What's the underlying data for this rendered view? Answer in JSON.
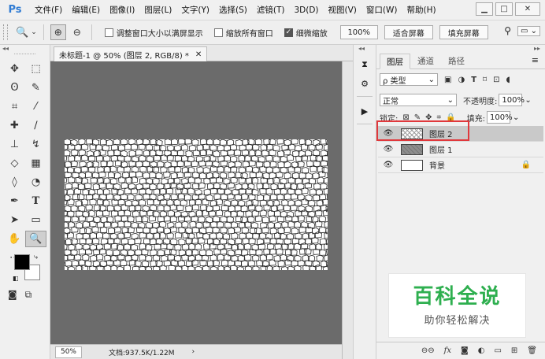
{
  "app": {
    "logo": "Ps",
    "menu": [
      "文件(F)",
      "编辑(E)",
      "图像(I)",
      "图层(L)",
      "文字(Y)",
      "选择(S)",
      "滤镜(T)",
      "3D(D)",
      "视图(V)",
      "窗口(W)",
      "帮助(H)"
    ],
    "window_controls": {
      "minimize": "▁",
      "maximize": "□",
      "close": "✕"
    }
  },
  "options": {
    "tool_icon": "magnifier-icon",
    "resize_windows": "调整窗口大小以满屏显示",
    "zoom_all_windows": "缩放所有窗口",
    "scrubby_zoom": "细微缩放",
    "resize_windows_checked": false,
    "zoom_all_checked": false,
    "scrubby_checked": true,
    "btn_100": "100%",
    "btn_fit": "适合屏幕",
    "btn_fill": "填充屏幕"
  },
  "document": {
    "tab_title": "未标题-1 @ 50% (图层 2, RGB/8) *",
    "zoom": "50%",
    "doc_info": "文档:937.5K/1.22M"
  },
  "layers_panel": {
    "tabs": [
      "图层",
      "通道",
      "路径"
    ],
    "filter_kind": "ρ 类型",
    "blend_mode": "正常",
    "opacity_label": "不透明度:",
    "opacity_value": "100%",
    "lock_label": "锁定:",
    "fill_label": "填充:",
    "fill_value": "100%",
    "layers": [
      {
        "name": "图层 2",
        "selected": true,
        "thumb": "pattern"
      },
      {
        "name": "图层 1",
        "selected": false,
        "thumb": "gray"
      },
      {
        "name": "背景",
        "selected": false,
        "thumb": "white",
        "locked": true
      }
    ]
  },
  "watermark": {
    "title": "百科全说",
    "subtitle": "助你轻松解决"
  },
  "colors": {
    "accent": "#2f7bd3",
    "highlight": "#e0383c",
    "watermark_green": "#2eaf4f",
    "canvas_bg": "#6b6b6b"
  }
}
